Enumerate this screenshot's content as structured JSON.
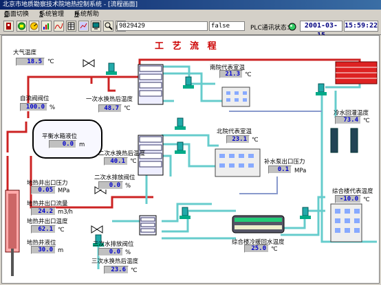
{
  "window": {
    "title": "北京市地质勘察技术院地热控制系统 - [流程画面]"
  },
  "menu": [
    {
      "label": "画面切换",
      "key": "C"
    },
    {
      "label": "系统管理",
      "key": "S"
    },
    {
      "label": "系统帮助",
      "key": "H"
    }
  ],
  "toolbar": {
    "icons": [
      "exit-icon",
      "monitor-icon",
      "gauge-icon",
      "chart-icon",
      "curve-icon",
      "table-icon",
      "trend-icon",
      "screen-icon",
      "search-icon",
      "print-icon"
    ],
    "text_value": "9829429",
    "flag_value": "false",
    "plc_label": "PLC通讯状态：",
    "date": "2001-03-15",
    "time": "15:59:22"
  },
  "scene": {
    "title": "工 艺 流 程",
    "readouts": {
      "atm_temp": {
        "label": "大气温度",
        "value": "18.5",
        "unit": "℃"
      },
      "self_valve": {
        "label": "自流阀阀位",
        "value": "100.0",
        "unit": "%"
      },
      "primary_after": {
        "label": "一次水换热后温度",
        "value": "48.7",
        "unit": "℃"
      },
      "balance_tank": {
        "label": "平衡水箱液位",
        "value": "0.0",
        "unit": "m"
      },
      "secondary_after": {
        "label": "二次水换热后温度",
        "value": "40.1",
        "unit": "℃"
      },
      "secondary_valve": {
        "label": "二次水排放阀位",
        "value": "0.0",
        "unit": "%"
      },
      "well_pressure": {
        "label": "地热井出口压力",
        "value": "0.05",
        "unit": "MPa"
      },
      "well_flow": {
        "label": "地热井出口流量",
        "value": "24.2",
        "unit": "m3/h"
      },
      "well_temp": {
        "label": "地热井出口温度",
        "value": "62.1",
        "unit": "℃"
      },
      "well_level": {
        "label": "地热井液位",
        "value": "30.0",
        "unit": "m"
      },
      "tertiary_valve": {
        "label": "三次水排放阀位",
        "value": "0.0",
        "unit": "%"
      },
      "tertiary_after": {
        "label": "三次水换热后温度",
        "value": "23.6",
        "unit": "℃"
      },
      "south_room": {
        "label": "南院代表室温",
        "value": "21.3",
        "unit": "℃"
      },
      "north_room": {
        "label": "北院代表室温",
        "value": "23.1",
        "unit": "℃"
      },
      "makeup_pressure": {
        "label": "补水泵出口压力",
        "value": "0.1",
        "unit": "MPa"
      },
      "cold_return": {
        "label": "冷水回灌温度",
        "value": "73.4",
        "unit": "℃"
      },
      "complex_room": {
        "label": "综合楼代表温度",
        "value": "-10.0",
        "unit": "℃"
      },
      "complex_hvac": {
        "label": "综合楼冷暖回水温度",
        "value": "25.0",
        "unit": "℃"
      }
    }
  }
}
